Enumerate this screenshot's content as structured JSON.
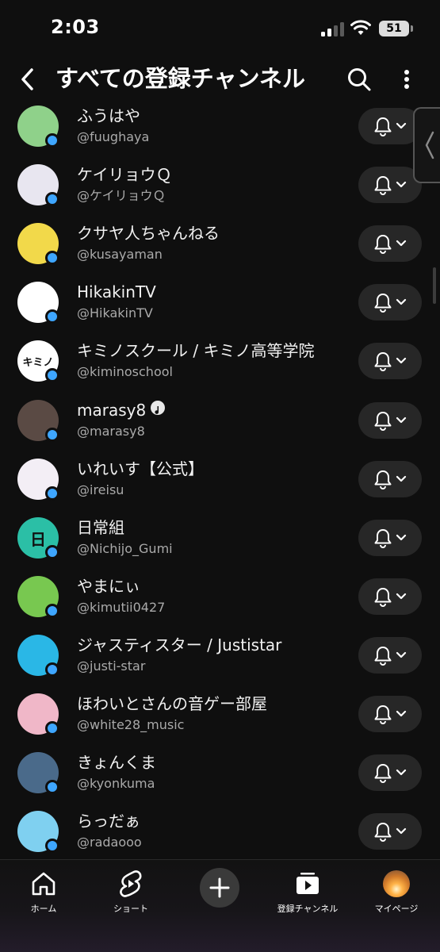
{
  "status_bar": {
    "time": "2:03",
    "battery": "51"
  },
  "header": {
    "title": "すべての登録チャンネル"
  },
  "channels": [
    {
      "name": "ふうはや",
      "handle": "@fuughaya",
      "avatar_color": "#8fd18a",
      "avatar_text": ""
    },
    {
      "name": "ケイリョウＱ",
      "handle": "@ケイリョウＱ",
      "avatar_color": "#e8e6f0",
      "avatar_text": ""
    },
    {
      "name": "クサヤ人ちゃんねる",
      "handle": "@kusayaman",
      "avatar_color": "#f2d94a",
      "avatar_text": ""
    },
    {
      "name": "HikakinTV",
      "handle": "@HikakinTV",
      "avatar_color": "#ffffff",
      "avatar_text": ""
    },
    {
      "name": "キミノスクール / キミノ高等学院",
      "handle": "@kiminoschool",
      "avatar_color": "#ffffff",
      "avatar_text": "キミノ"
    },
    {
      "name": "marasy8",
      "handle": "@marasy8",
      "avatar_color": "#5a4a44",
      "avatar_text": "",
      "verified": true
    },
    {
      "name": "いれいす【公式】",
      "handle": "@ireisu",
      "avatar_color": "#f3eef5",
      "avatar_text": ""
    },
    {
      "name": "日常組",
      "handle": "@Nichijo_Gumi",
      "avatar_color": "#2bbfa6",
      "avatar_text": "日"
    },
    {
      "name": "やまにぃ",
      "handle": "@kimutii0427",
      "avatar_color": "#78c850",
      "avatar_text": ""
    },
    {
      "name": "ジャスティスター / Justistar",
      "handle": "@justi-star",
      "avatar_color": "#2ab7e6",
      "avatar_text": ""
    },
    {
      "name": "ほわいとさんの音ゲー部屋",
      "handle": "@white28_music",
      "avatar_color": "#f0b7c8",
      "avatar_text": ""
    },
    {
      "name": "きょんくま",
      "handle": "@kyonkuma",
      "avatar_color": "#4a6a8a",
      "avatar_text": ""
    },
    {
      "name": "らっだぁ",
      "handle": "@radaooo",
      "avatar_color": "#7fd0f0",
      "avatar_text": ""
    }
  ],
  "nav": {
    "home": "ホーム",
    "shorts": "ショート",
    "subscriptions": "登録チャンネル",
    "mypage": "マイページ"
  },
  "icons": {
    "back": "chevron-left-icon",
    "search": "search-icon",
    "more": "more-vertical-icon",
    "bell": "bell-icon",
    "dropdown": "chevron-down-icon",
    "home": "home-icon",
    "shorts": "shorts-icon",
    "create": "plus-icon",
    "subscriptions": "subscriptions-icon"
  },
  "colors": {
    "background": "#0f0f0f",
    "button_bg": "#272727",
    "live_dot": "#3ea6ff",
    "secondary_text": "#aaaaaa"
  }
}
